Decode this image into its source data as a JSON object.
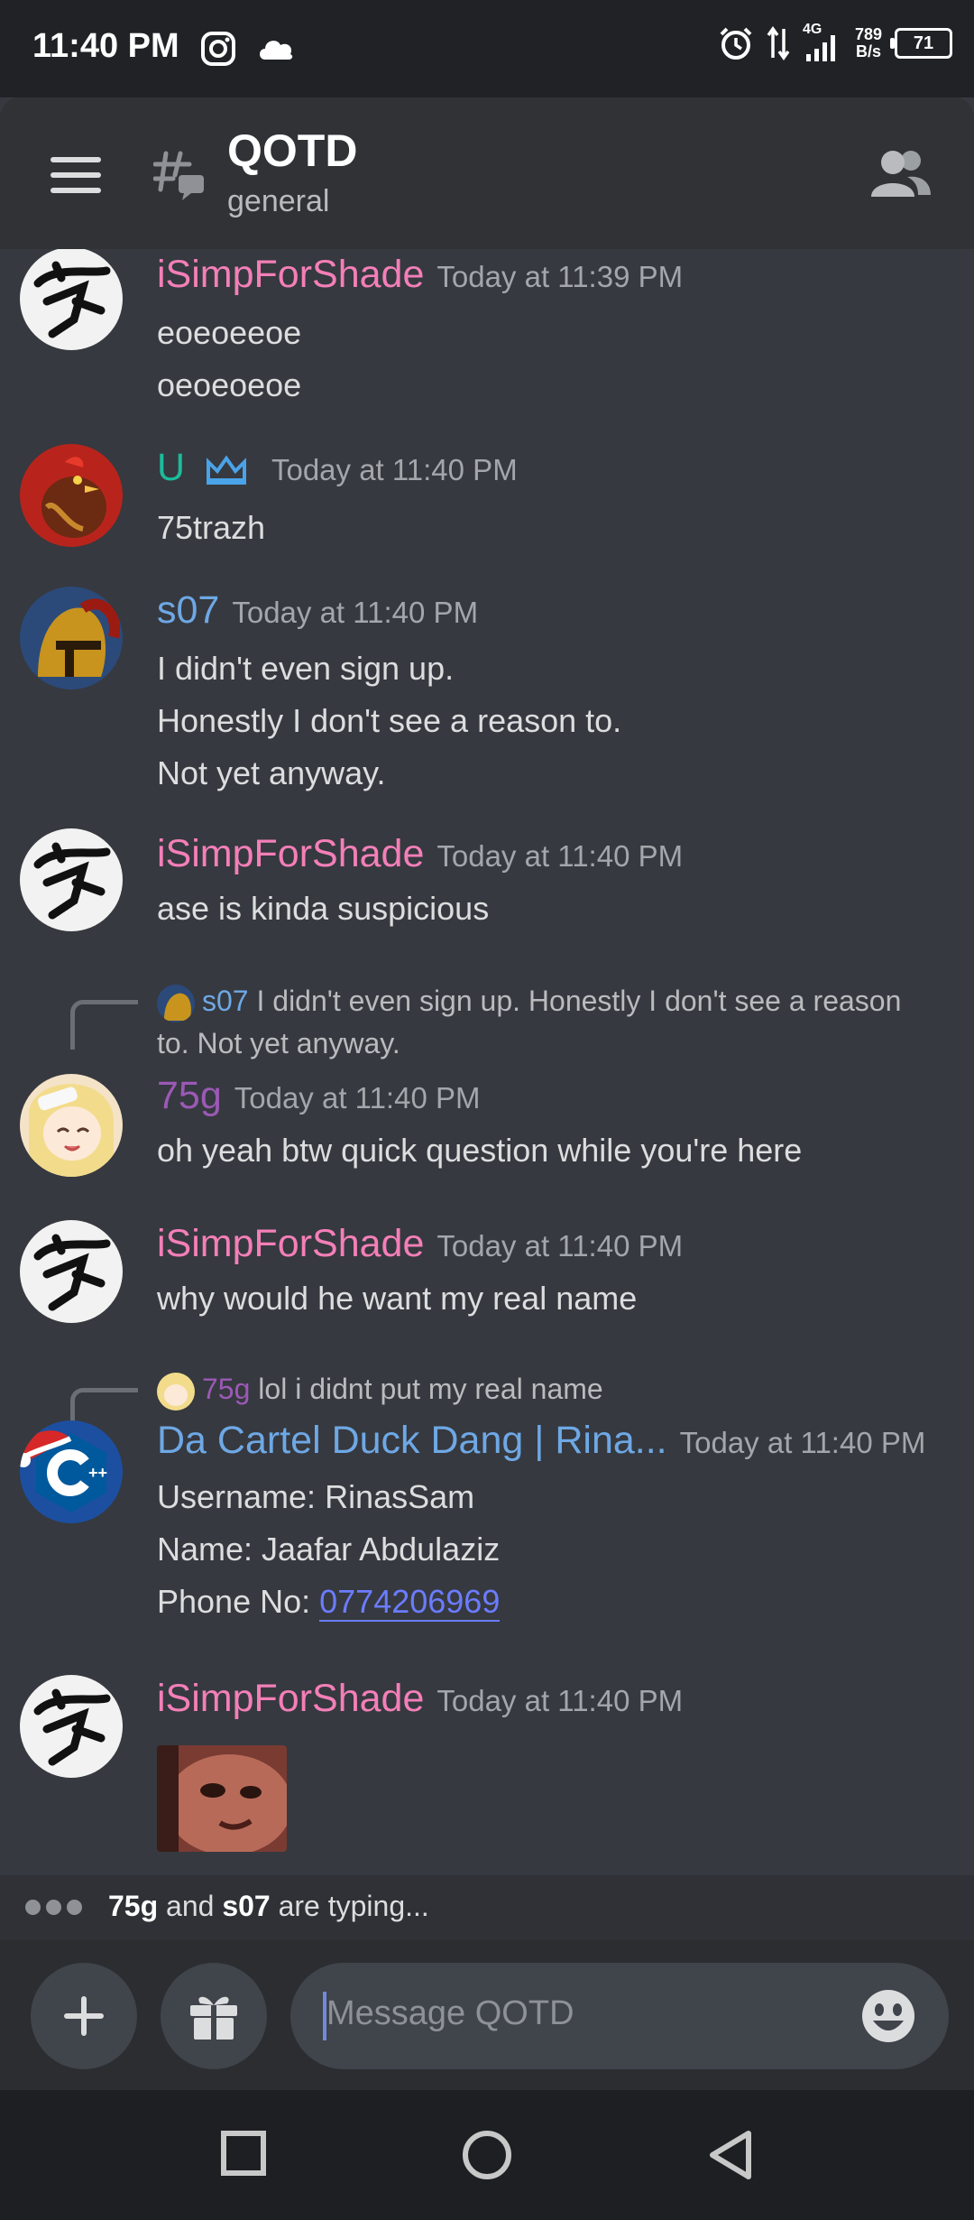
{
  "status_bar": {
    "time": "11:40 PM",
    "network": "4G",
    "speed_value": "789",
    "speed_unit": "B/s",
    "battery": "71"
  },
  "header": {
    "title": "QOTD",
    "subtitle": "general"
  },
  "messages": [
    {
      "author": "iSimpForShade",
      "time": "Today at 11:39 PM",
      "lines": [
        "eoeoeeoe",
        "oeoeoeoe"
      ]
    },
    {
      "author": "U",
      "time": "Today at 11:40 PM",
      "lines": [
        "75trazh"
      ]
    },
    {
      "author": "s07",
      "time": "Today at 11:40 PM",
      "lines": [
        "I didn't even sign up.",
        "Honestly I don't see a reason to.",
        "Not yet anyway."
      ]
    },
    {
      "author": "iSimpForShade",
      "time": "Today at 11:40 PM",
      "lines": [
        "ase is kinda suspicious"
      ]
    },
    {
      "reply_author": "s07",
      "reply_text_1": "I didn't even sign up. Honestly I don't see a reason",
      "reply_text_2": "to. Not yet anyway.",
      "author": "75g",
      "time": "Today at 11:40 PM",
      "lines": [
        "oh yeah btw quick question while you're here"
      ]
    },
    {
      "author": "iSimpForShade",
      "time": "Today at 11:40 PM",
      "lines": [
        "why would he want my real name"
      ]
    },
    {
      "reply_author": "75g",
      "reply_text_1": "lol i didnt put my real name",
      "author": "Da Cartel Duck Dang | Rina...",
      "time": "Today at 11:40 PM",
      "lines": [
        "Username: RinasSam",
        "Name: Jaafar Abdulaziz"
      ],
      "phone_label": "Phone No: ",
      "phone_number": "0774206969"
    },
    {
      "author": "iSimpForShade",
      "time": "Today at 11:40 PM",
      "lines": []
    }
  ],
  "typing": {
    "user1": "75g",
    "joiner": " and ",
    "user2": "s07",
    "suffix": " are typing..."
  },
  "composer": {
    "placeholder": "Message QOTD"
  },
  "colors": {
    "background": "#36393f",
    "pink_role": "#f47fb8",
    "cyan_role": "#1abc9c",
    "blue_role": "#6ea8e5",
    "purple_role": "#9b59b6",
    "link": "#6b7cff"
  },
  "icons": [
    "instagram-icon",
    "cloud-icon",
    "alarm-icon",
    "signal-icon",
    "menu-icon",
    "thread-icon",
    "members-icon",
    "crown-icon",
    "plus-icon",
    "gift-icon",
    "emoji-icon",
    "square-icon",
    "circle-icon",
    "back-icon"
  ]
}
